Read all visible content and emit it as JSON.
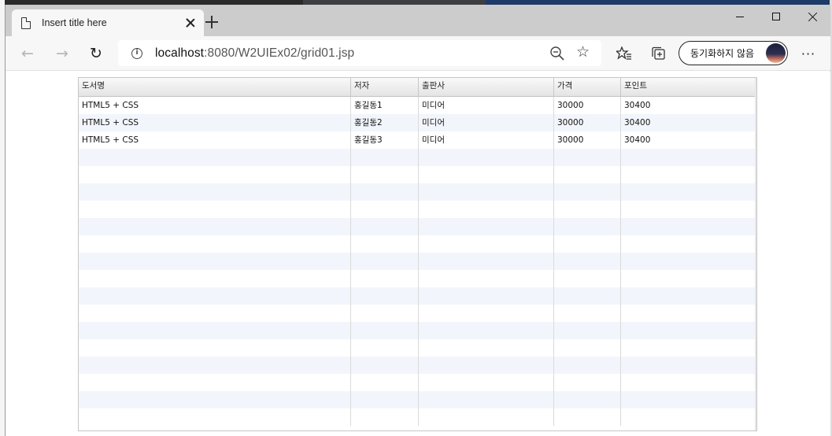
{
  "tab": {
    "title": "Insert title here"
  },
  "address": {
    "url_host": "localhost",
    "url_path": ":8080/W2UIEx02/grid01.jsp"
  },
  "profile": {
    "label": "동기화하지 않음"
  },
  "icons": {
    "back": "back-arrow-icon",
    "forward": "forward-arrow-icon",
    "refresh": "refresh-icon",
    "favorites": "favorites-icon",
    "collections": "collections-icon",
    "more": "more-icon"
  },
  "grid": {
    "columns": [
      "도서명",
      "저자",
      "출판사",
      "가격",
      "포인트"
    ],
    "rows": [
      [
        "HTML5 + CSS",
        "홍길동1",
        "미디어",
        "30000",
        "30400"
      ],
      [
        "HTML5 + CSS",
        "홍길동2",
        "미디어",
        "30000",
        "30400"
      ],
      [
        "HTML5 + CSS",
        "홍길동3",
        "미디어",
        "30000",
        "30400"
      ]
    ],
    "stripe_color": "#f2f6fc"
  }
}
